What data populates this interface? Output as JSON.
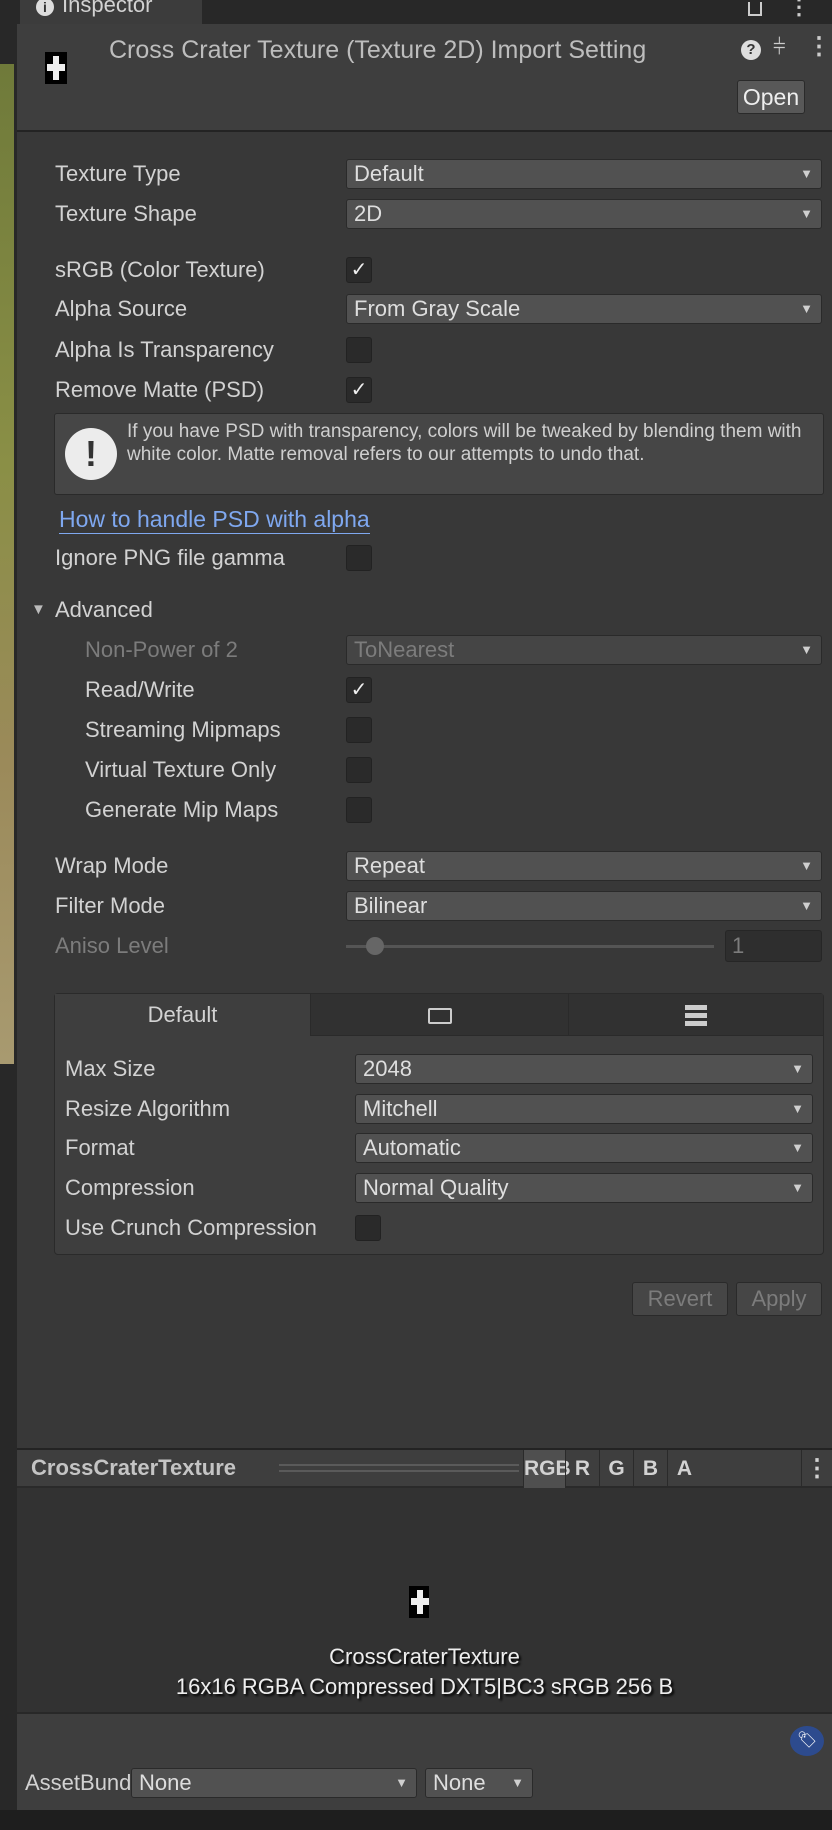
{
  "window": {
    "tab_title": "Inspector"
  },
  "header": {
    "title": "Cross Crater Texture (Texture 2D) Import Setting",
    "open_label": "Open"
  },
  "fields": {
    "texture_type": {
      "label": "Texture Type",
      "value": "Default"
    },
    "texture_shape": {
      "label": "Texture Shape",
      "value": "2D"
    },
    "srgb": {
      "label": "sRGB (Color Texture)",
      "checked": "✓"
    },
    "alpha_source": {
      "label": "Alpha Source",
      "value": "From Gray Scale"
    },
    "alpha_transparency": {
      "label": "Alpha Is Transparency"
    },
    "remove_matte": {
      "label": "Remove Matte (PSD)",
      "checked": "✓"
    },
    "help_text": "If you have PSD with transparency, colors will be tweaked by blending them with white color. Matte removal refers to our attempts to undo that.",
    "help_link": "How to handle PSD with alpha",
    "ignore_png_gamma": {
      "label": "Ignore PNG file gamma"
    },
    "advanced": {
      "label": "Advanced"
    },
    "npot": {
      "label": "Non-Power of 2",
      "value": "ToNearest"
    },
    "read_write": {
      "label": "Read/Write",
      "checked": "✓"
    },
    "streaming_mipmaps": {
      "label": "Streaming Mipmaps"
    },
    "virtual_texture": {
      "label": "Virtual Texture Only"
    },
    "generate_mipmaps": {
      "label": "Generate Mip Maps"
    },
    "wrap_mode": {
      "label": "Wrap Mode",
      "value": "Repeat"
    },
    "filter_mode": {
      "label": "Filter Mode",
      "value": "Bilinear"
    },
    "aniso_level": {
      "label": "Aniso Level",
      "value": "1"
    }
  },
  "platform": {
    "tabs": [
      "Default"
    ],
    "max_size": {
      "label": "Max Size",
      "value": "2048"
    },
    "resize": {
      "label": "Resize Algorithm",
      "value": "Mitchell"
    },
    "format": {
      "label": "Format",
      "value": "Automatic"
    },
    "compression": {
      "label": "Compression",
      "value": "Normal Quality"
    },
    "crunch": {
      "label": "Use Crunch Compression"
    }
  },
  "actions": {
    "revert": "Revert",
    "apply": "Apply"
  },
  "preview": {
    "title": "CrossCraterTexture",
    "channels": [
      "RGB",
      "R",
      "G",
      "B",
      "A"
    ],
    "name": "CrossCraterTexture",
    "info": "16x16  RGBA Compressed DXT5|BC3 sRGB   256 B"
  },
  "asset_bundle": {
    "label": "AssetBundle",
    "name": "None",
    "variant": "None"
  },
  "colors": {
    "link": "#7fa8f0",
    "tag_badge": "#2d4b8e"
  }
}
